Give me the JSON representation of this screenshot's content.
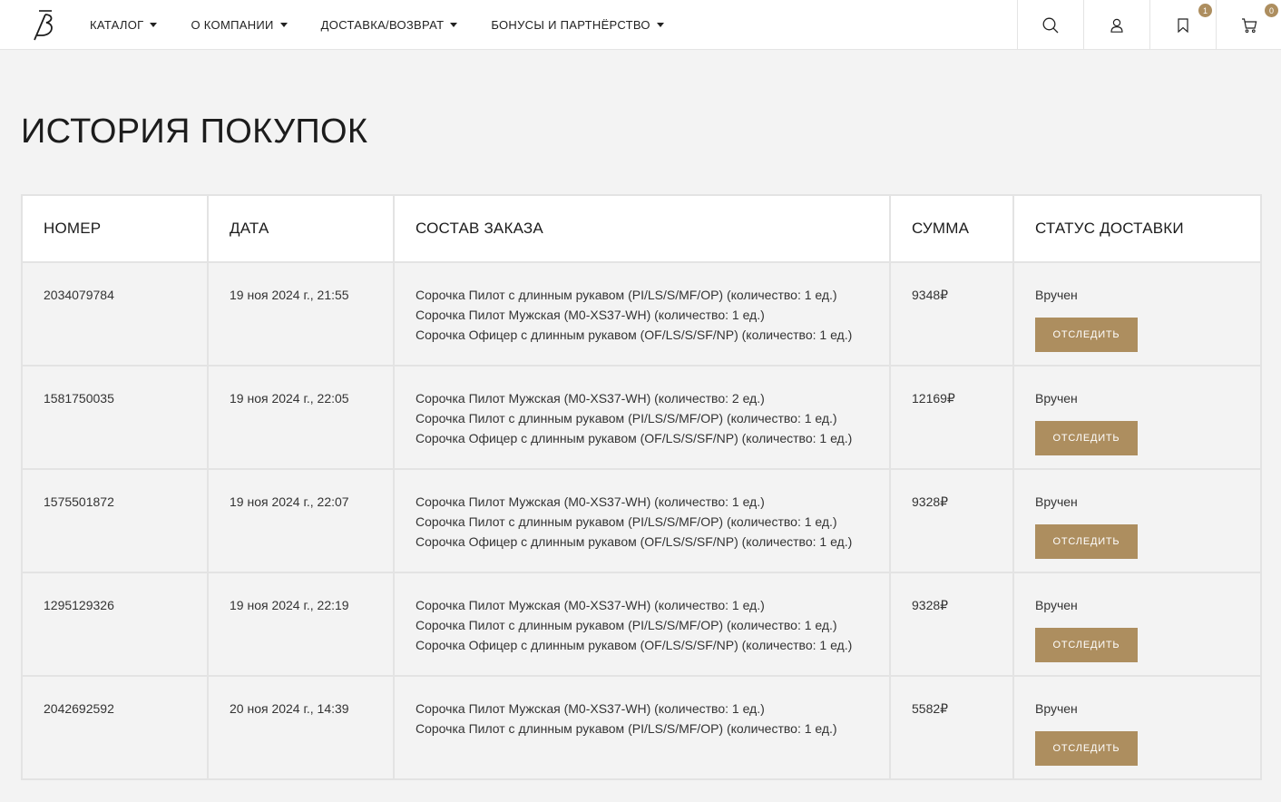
{
  "nav": {
    "items": [
      {
        "label": "КАТАЛОГ"
      },
      {
        "label": "О КОМПАНИИ"
      },
      {
        "label": "ДОСТАВКА/ВОЗВРАТ"
      },
      {
        "label": "БОНУСЫ И ПАРТНЁРСТВО"
      }
    ]
  },
  "header": {
    "bookmark_count": "1",
    "cart_count": "0",
    "accent_color": "#ad8e5f"
  },
  "page": {
    "title": "ИСТОРИЯ ПОКУПОК"
  },
  "table": {
    "columns": [
      "НОМЕР",
      "ДАТА",
      "СОСТАВ ЗАКАЗА",
      "СУММА",
      "СТАТУС ДОСТАВКИ"
    ],
    "track_label": "ОТСЛЕДИТЬ",
    "rows": [
      {
        "number": "2034079784",
        "date": "19 ноя 2024 г., 21:55",
        "items": [
          "Сорочка Пилот с длинным рукавом (PI/LS/S/MF/OP) (количество: 1 ед.)",
          "Сорочка Пилот Мужская (M0-XS37-WH) (количество: 1 ед.)",
          "Сорочка Офицер с длинным рукавом (OF/LS/S/SF/NP) (количество: 1 ед.)"
        ],
        "sum": "9348₽",
        "status": "Вручен"
      },
      {
        "number": "1581750035",
        "date": "19 ноя 2024 г., 22:05",
        "items": [
          "Сорочка Пилот Мужская (M0-XS37-WH) (количество: 2 ед.)",
          "Сорочка Пилот с длинным рукавом (PI/LS/S/MF/OP) (количество: 1 ед.)",
          "Сорочка Офицер с длинным рукавом (OF/LS/S/SF/NP) (количество: 1 ед.)"
        ],
        "sum": "12169₽",
        "status": "Вручен"
      },
      {
        "number": "1575501872",
        "date": "19 ноя 2024 г., 22:07",
        "items": [
          "Сорочка Пилот Мужская (M0-XS37-WH) (количество: 1 ед.)",
          "Сорочка Пилот с длинным рукавом (PI/LS/S/MF/OP) (количество: 1 ед.)",
          "Сорочка Офицер с длинным рукавом (OF/LS/S/SF/NP) (количество: 1 ед.)"
        ],
        "sum": "9328₽",
        "status": "Вручен"
      },
      {
        "number": "1295129326",
        "date": "19 ноя 2024 г., 22:19",
        "items": [
          "Сорочка Пилот Мужская (M0-XS37-WH) (количество: 1 ед.)",
          "Сорочка Пилот с длинным рукавом (PI/LS/S/MF/OP) (количество: 1 ед.)",
          "Сорочка Офицер с длинным рукавом (OF/LS/S/SF/NP) (количество: 1 ед.)"
        ],
        "sum": "9328₽",
        "status": "Вручен"
      },
      {
        "number": "2042692592",
        "date": "20 ноя 2024 г., 14:39",
        "items": [
          "Сорочка Пилот Мужская (M0-XS37-WH) (количество: 1 ед.)",
          "Сорочка Пилот с длинным рукавом (PI/LS/S/MF/OP) (количество: 1 ед.)"
        ],
        "sum": "5582₽",
        "status": "Вручен"
      }
    ]
  }
}
